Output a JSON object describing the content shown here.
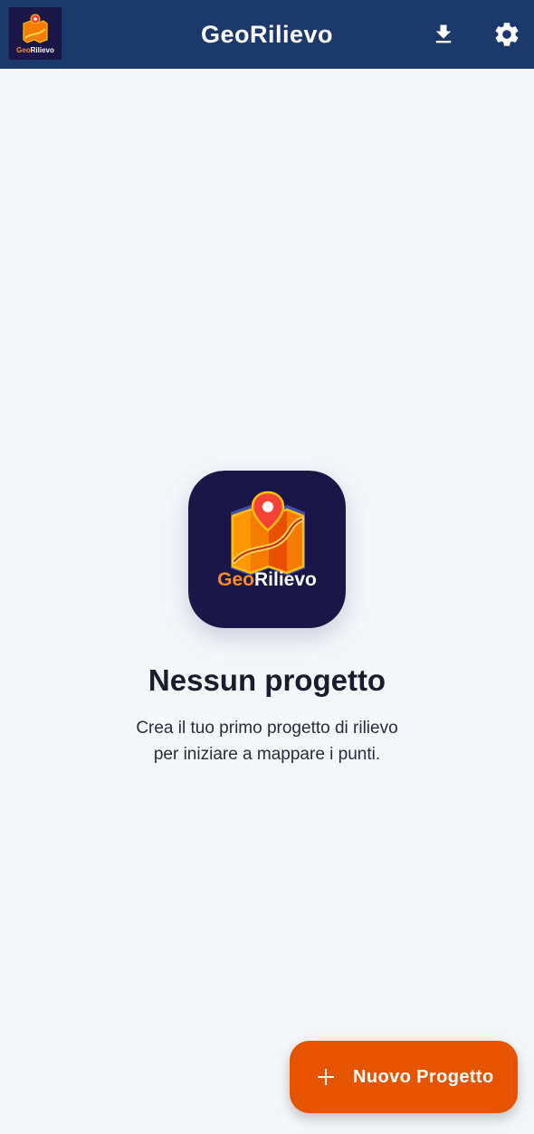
{
  "appbar": {
    "title": "GeoRilievo",
    "logo_text": "GeoRilievo",
    "download_icon": "download-icon",
    "settings_icon": "gear-icon"
  },
  "empty_state": {
    "logo_text_geo": "Geo",
    "logo_text_rilievo": "Rilievo",
    "title": "Nessun progetto",
    "description_line1": "Crea il tuo primo progetto di rilievo",
    "description_line2": "per iniziare a mappare i punti."
  },
  "fab": {
    "icon": "plus-icon",
    "label": "Nuovo Progetto"
  },
  "colors": {
    "appbar": "#1b3a6b",
    "background": "#f4f6fa",
    "accent": "#e65400",
    "logo_bg": "#1a1748"
  }
}
